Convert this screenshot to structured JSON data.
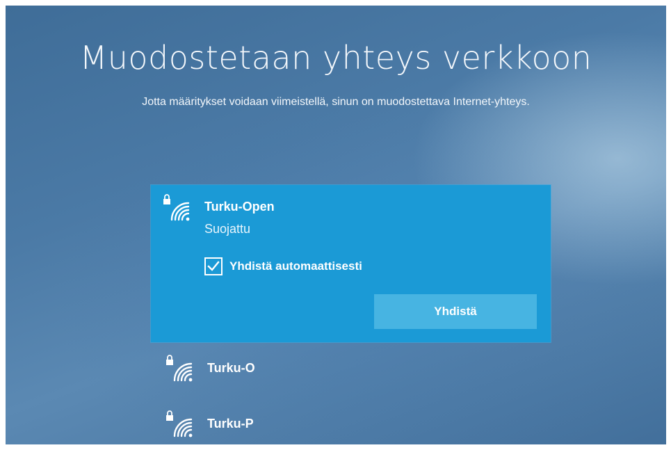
{
  "header": {
    "title": "Muodostetaan yhteys verkkoon",
    "subtitle": "Jotta määritykset voidaan viimeistellä, sinun on muodostettava Internet-yhteys."
  },
  "networks": [
    {
      "name": "Turku-Open",
      "status": "Suojattu",
      "icon": "wifi-secured-icon",
      "selected": true,
      "auto_connect_label": "Yhdistä automaattisesti",
      "auto_connect_checked": true,
      "connect_label": "Yhdistä"
    },
    {
      "name": "Turku-O",
      "icon": "wifi-secured-icon",
      "selected": false
    },
    {
      "name": "Turku-P",
      "icon": "wifi-secured-icon",
      "selected": false
    }
  ],
  "colors": {
    "background": "#4b7aa6",
    "selected_item": "#1b9ad6",
    "connect_button": "#47b4e2",
    "text": "#ffffff"
  }
}
